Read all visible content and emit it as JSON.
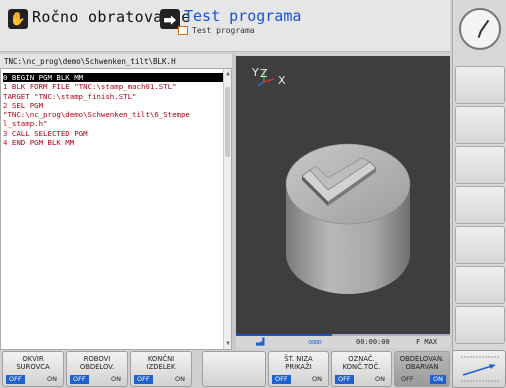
{
  "header": {
    "left_mode": "Ročno obratovanje",
    "right_mode": "Test programa",
    "right_submode": "Test programa"
  },
  "path": "TNC:\\nc_prog\\demo\\Schwenken_tilt\\BLK.H",
  "program": {
    "lines": [
      {
        "num": "0",
        "text": "BEGIN PGM BLK MM",
        "active": true
      },
      {
        "num": "1",
        "text": "BLK FORM FILE \"TNC:\\stamp_mach01.STL\"",
        "active": false
      },
      {
        "num": "",
        "text": "TARGET \"TNC:\\stamp_finish.STL\"",
        "active": false
      },
      {
        "num": "2",
        "text": "SEL PGM",
        "active": false
      },
      {
        "num": "",
        "text": "\"TNC:\\nc_prog\\demo\\Schwenken_tilt\\6_Stempe",
        "active": false
      },
      {
        "num": "",
        "text": "l_stamp.h\"",
        "active": false
      },
      {
        "num": "3",
        "text": "CALL SELECTED PGM",
        "active": false
      },
      {
        "num": "4",
        "text": "END PGM BLK MM",
        "active": false
      }
    ]
  },
  "graphics": {
    "axis_y": "Y",
    "axis_z": "Z",
    "axis_x": "X",
    "background": "#3e3e3e",
    "part_color": "#b0b0b0"
  },
  "status": {
    "progress": 0.45,
    "dots": "oooo",
    "time": "00:00:00",
    "feed": "F MAX"
  },
  "softkeys": [
    {
      "l1": "OKVIR",
      "l2": "SUROVCA",
      "off": "OFF",
      "on": "ON",
      "state": "off"
    },
    {
      "l1": "ROBOVI",
      "l2": "OBDELOV.",
      "off": "OFF",
      "on": "ON",
      "state": "off"
    },
    {
      "l1": "KONČNI",
      "l2": "IZDELEK",
      "off": "OFF",
      "on": "ON",
      "state": "off"
    },
    {
      "l1": "",
      "l2": "",
      "off": "",
      "on": "",
      "state": "none"
    },
    {
      "l1": "ŠT. NIZA",
      "l2": "PRIKAŽI",
      "off": "OFF",
      "on": "ON",
      "state": "off"
    },
    {
      "l1": "OZNAČ.",
      "l2": "KONČ.TOČ.",
      "off": "OFF",
      "on": "ON",
      "state": "off"
    },
    {
      "l1": "OBDELOVAN.",
      "l2": "OBARVAN",
      "off": "OFF",
      "on": "ON",
      "state": "on"
    }
  ],
  "colors": {
    "accent_blue": "#2060d0",
    "program_red": "#b00018"
  }
}
